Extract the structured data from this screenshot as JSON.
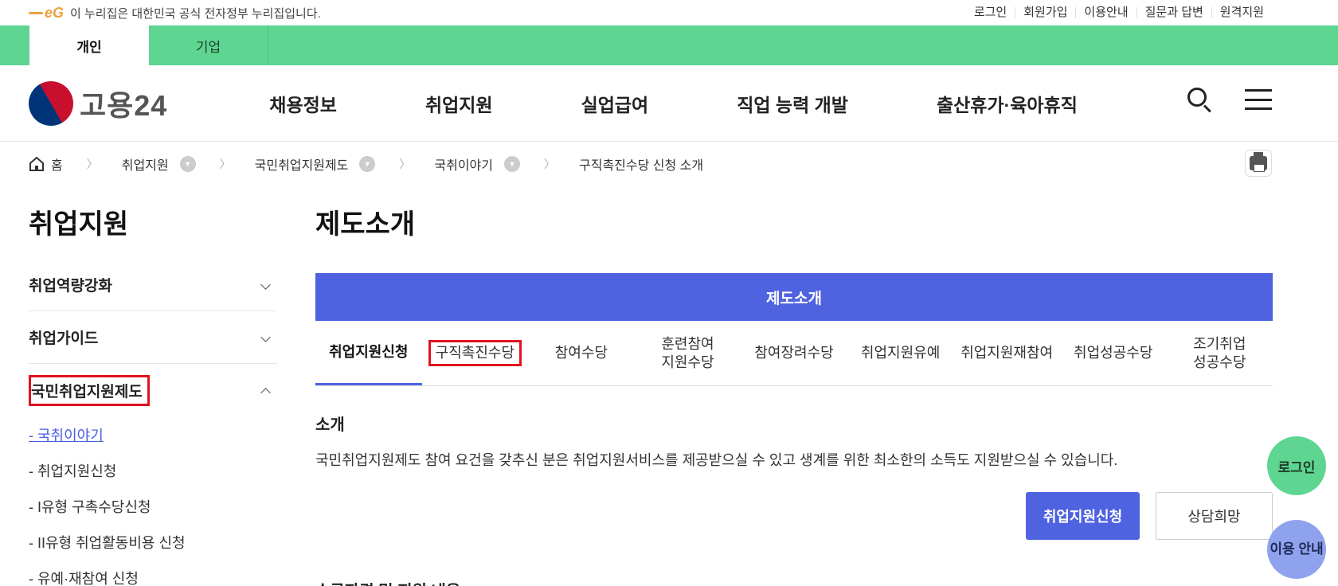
{
  "gov_bar": {
    "logo_text": "eG",
    "notice": "이 누리집은 대한민국 공식 전자정부 누리집입니다.",
    "links": [
      "로그인",
      "회원가입",
      "이용안내",
      "질문과 답변",
      "원격지원"
    ]
  },
  "user_tabs": [
    "개인",
    "기업"
  ],
  "header": {
    "logo_text": "고용24",
    "nav": [
      "채용정보",
      "취업지원",
      "실업급여",
      "직업 능력 개발",
      "출산휴가·육아휴직"
    ]
  },
  "breadcrumb": {
    "home": "홈",
    "items": [
      "취업지원",
      "국민취업지원제도",
      "국취이야기",
      "구직촉진수당 신청 소개"
    ]
  },
  "sidebar": {
    "title": "취업지원",
    "items": [
      "취업역량강화",
      "취업가이드",
      "국민취업지원제도"
    ],
    "sub_items": [
      "- 국취이야기",
      "- 취업지원신청",
      "- I유형 구촉수당신청",
      "- II유형 취업활동비용 신청",
      "- 유예·재참여 신청"
    ]
  },
  "main": {
    "title": "제도소개",
    "banner": "제도소개",
    "tabs": [
      "취업지원신청",
      "구직촉진수당",
      "참여수당",
      "훈련참여\n지원수당",
      "참여장려수당",
      "취업지원유예",
      "취업지원재참여",
      "취업성공수당",
      "조기취업\n성공수당"
    ],
    "section_heading": "소개",
    "section_text": "국민취업지원제도 참여 요건을 갖추신 분은 취업지원서비스를 제공받으실 수 있고 생계를 위한 최소한의 소득도 지원받으실 수 있습니다.",
    "btn_apply": "취업지원신청",
    "btn_consult": "상담희망",
    "next_heading": "수급자격 및 지원 내용"
  },
  "floating": {
    "login": "로그인",
    "guide": "이용 안내"
  },
  "colors": {
    "green": "#5ed591",
    "primary": "#4f63e0",
    "highlight_red": "#e0121f"
  }
}
